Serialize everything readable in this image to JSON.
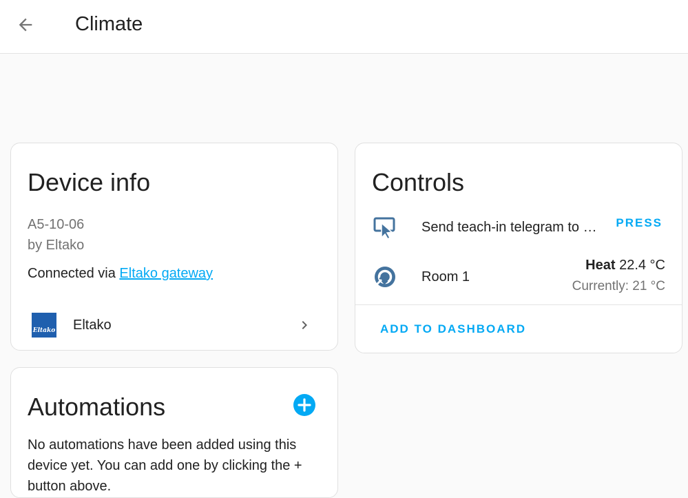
{
  "header": {
    "title": "Climate",
    "back_icon": "arrow-left-icon"
  },
  "device_info": {
    "title": "Device info",
    "model": "A5-10-06",
    "manufacturer": "by Eltako",
    "connected_prefix": "Connected via ",
    "connected_link": "Eltako gateway",
    "integration": {
      "logo_text": "Eltako",
      "name": "Eltako",
      "chevron_icon": "chevron-right-icon"
    }
  },
  "controls": {
    "title": "Controls",
    "rows": [
      {
        "icon": "gesture-tap-icon",
        "label": "Send teach-in telegram to …",
        "action": "PRESS"
      },
      {
        "icon": "thermostat-icon",
        "label": "Room 1",
        "state_mode": "Heat",
        "state_value": " 22.4 °C",
        "current": "Currently: 21 °C"
      }
    ],
    "add_to_dashboard": "ADD TO DASHBOARD"
  },
  "automations": {
    "title": "Automations",
    "add_icon": "plus-circle-icon",
    "empty_text": "No automations have been added using this device yet. You can add one by clicking the + button above."
  },
  "colors": {
    "accent": "#03a9f4",
    "icon": "#44739e",
    "background": "#fafafa",
    "card": "#ffffff",
    "eltako_blue": "#1f5fae"
  }
}
